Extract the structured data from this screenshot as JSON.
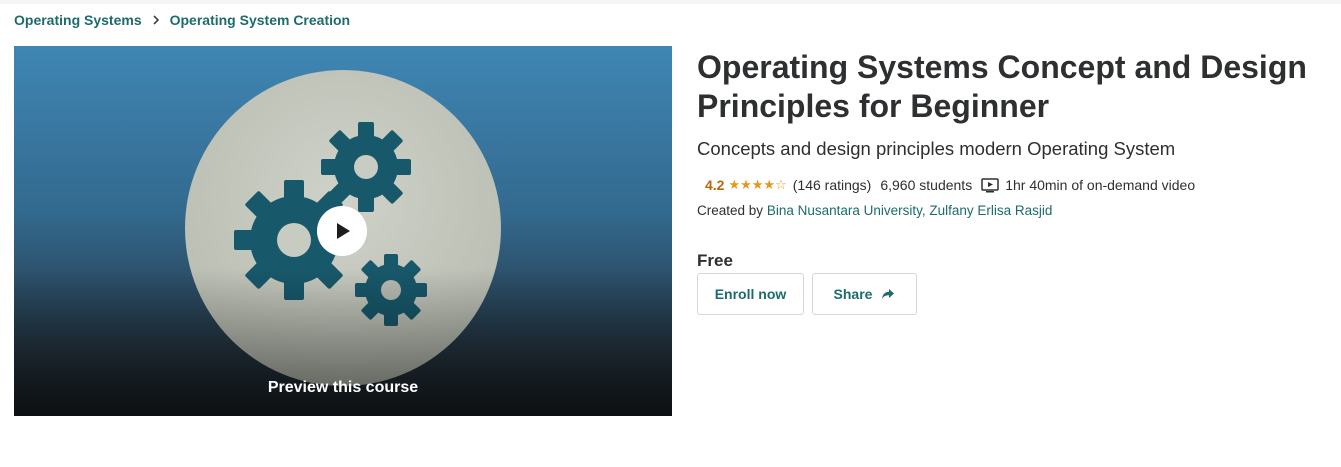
{
  "breadcrumb": {
    "items": [
      {
        "label": "Operating Systems"
      },
      {
        "label": "Operating System Creation"
      }
    ]
  },
  "preview": {
    "label": "Preview this course",
    "icon": "play-icon"
  },
  "course": {
    "title": "Operating Systems Concept and Design Principles for Beginner",
    "subtitle": "Concepts and design principles modern Operating System",
    "rating": "4.2",
    "rating_value": 4.2,
    "stars_max": 5,
    "stars_display": "★★★★☆",
    "ratings_count": "(146 ratings)",
    "students": "6,960 students",
    "video_length": "1hr 40min of on-demand video",
    "created_by_label": "Created by",
    "authors": "Bina Nusantara University, Zulfany Erlisa Rasjid",
    "price": "Free"
  },
  "actions": {
    "enroll_label": "Enroll now",
    "share_label": "Share"
  },
  "colors": {
    "link": "#1e6b6b",
    "rating": "#b4690e",
    "star": "#e59819",
    "text": "#2d2f31",
    "gear": "#17586a"
  }
}
